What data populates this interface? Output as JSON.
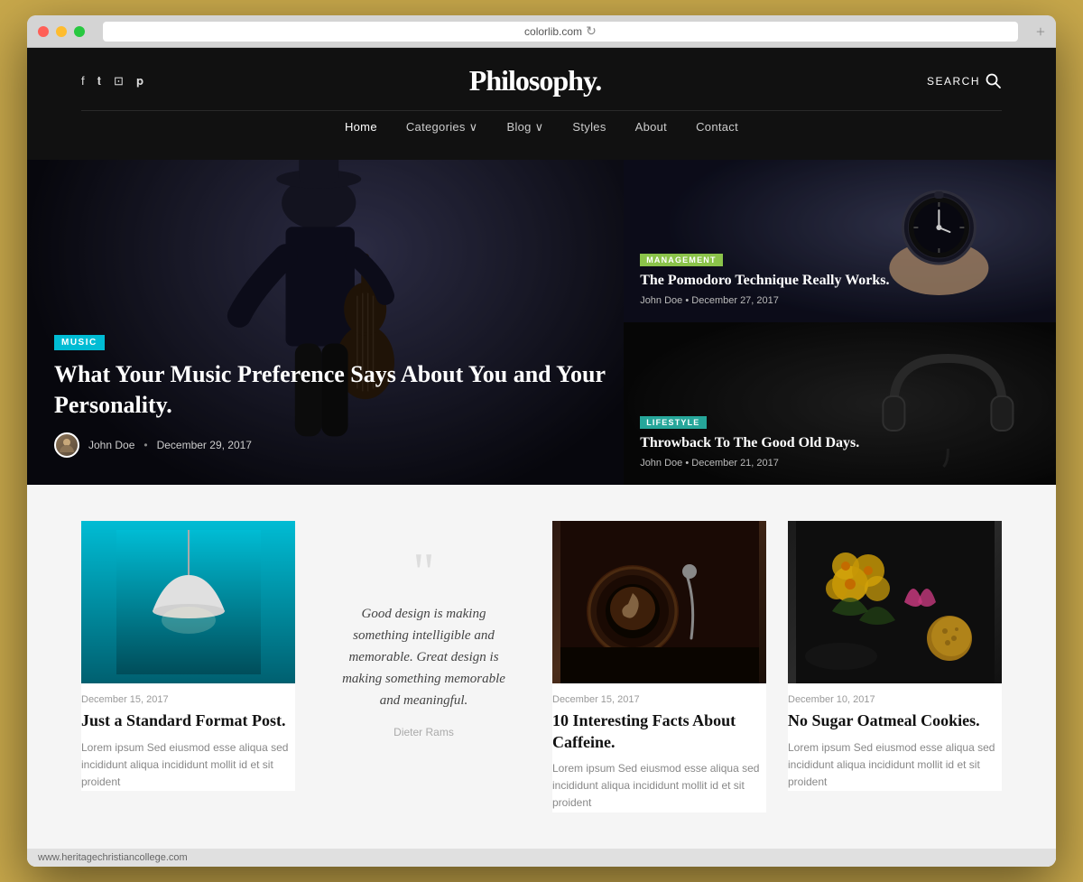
{
  "browser": {
    "url": "colorlib.com",
    "new_tab_label": "+"
  },
  "header": {
    "logo": "Philosophy.",
    "search_label": "SEARCH",
    "social": [
      "f",
      "𝕥",
      "⊡",
      "℗"
    ],
    "nav_items": [
      {
        "label": "Home",
        "active": true
      },
      {
        "label": "Categories ∨",
        "active": false
      },
      {
        "label": "Blog ∨",
        "active": false
      },
      {
        "label": "Styles",
        "active": false
      },
      {
        "label": "About",
        "active": false
      },
      {
        "label": "Contact",
        "active": false
      }
    ]
  },
  "hero": {
    "main": {
      "tag": "MUSIC",
      "title": "What Your Music Preference Says About You and Your Personality.",
      "author": "John Doe",
      "date": "December 29, 2017"
    },
    "card1": {
      "tag": "MANAGEMENT",
      "title": "The Pomodoro Technique Really Works.",
      "author": "John Doe",
      "date": "December 27, 2017"
    },
    "card2": {
      "tag": "LIFESTYLE",
      "title": "Throwback To The Good Old Days.",
      "author": "John Doe",
      "date": "December 21, 2017"
    }
  },
  "posts": [
    {
      "date": "December 15, 2017",
      "title": "Just a Standard Format Post.",
      "excerpt": "Lorem ipsum Sed eiusmod esse aliqua sed incididunt aliqua incididunt mollit id et sit proident"
    },
    {
      "type": "quote",
      "text": "Good design is making something intelligible and memorable. Great design is making something memorable and meaningful.",
      "author": "Dieter Rams"
    },
    {
      "date": "December 15, 2017",
      "title": "10 Interesting Facts About Caffeine.",
      "excerpt": "Lorem ipsum Sed eiusmod esse aliqua sed incididunt aliqua incididunt mollit id et sit proident"
    },
    {
      "date": "December 10, 2017",
      "title": "No Sugar Oatmeal Cookies.",
      "excerpt": "Lorem ipsum Sed eiusmod esse aliqua sed incididunt aliqua incididunt mollit id et sit proident"
    }
  ],
  "footer": {
    "url": "www.heritagechristiancollege.com"
  },
  "colors": {
    "music_tag": "#00bcd4",
    "management_tag": "#8bc34a",
    "lifestyle_tag": "#26a69a",
    "dark_bg": "#111111",
    "light_bg": "#f5f5f5"
  }
}
